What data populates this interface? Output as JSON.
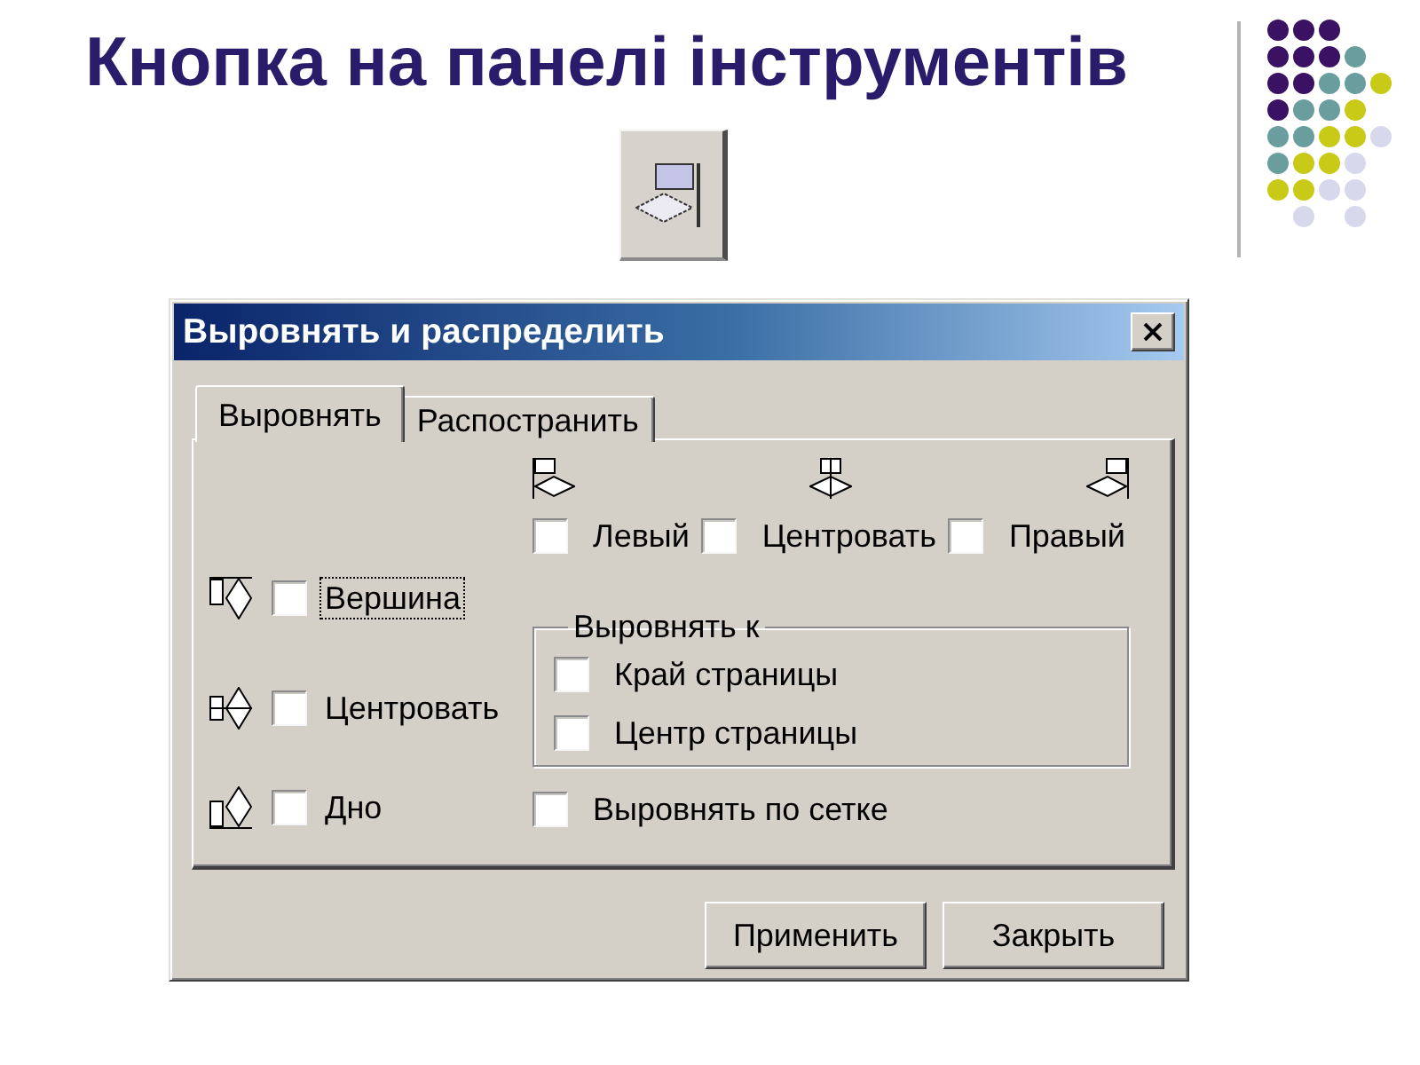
{
  "slide": {
    "title": "Кнопка на панелі інструментів"
  },
  "dialog": {
    "title": "Выровнять и распределить",
    "tabs": [
      {
        "label": "Выровнять",
        "selected": true
      },
      {
        "label": "Распостранить",
        "selected": false
      }
    ],
    "horizontal_align": [
      {
        "kind": "left",
        "label": "Левый",
        "checked": false
      },
      {
        "kind": "center",
        "label": "Центровать",
        "checked": false
      },
      {
        "kind": "right",
        "label": "Правый",
        "checked": false
      }
    ],
    "vertical_align": [
      {
        "kind": "top",
        "label": "Вершина",
        "checked": false,
        "focused": true
      },
      {
        "kind": "middle",
        "label": "Центровать",
        "checked": false,
        "focused": false
      },
      {
        "kind": "bottom",
        "label": "Дно",
        "checked": false,
        "focused": false
      }
    ],
    "align_to": {
      "title": "Выровнять к",
      "options": [
        {
          "label": "Край страницы",
          "checked": false
        },
        {
          "label": "Центр страницы",
          "checked": false
        }
      ]
    },
    "snap_to_grid": {
      "label": "Выровнять по сетке",
      "checked": false
    },
    "buttons": [
      {
        "label": "Применить"
      },
      {
        "label": "Закрыть"
      }
    ]
  }
}
